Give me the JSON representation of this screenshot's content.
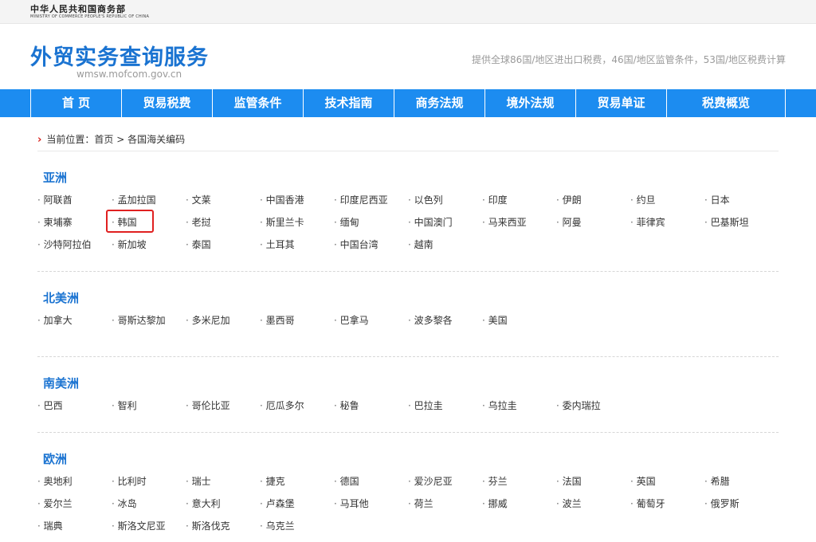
{
  "top": {
    "ministry_cn": "中华人民共和国商务部",
    "ministry_en": "MINISTRY OF COMMERCE PEOPLE'S REPUBLIC OF CHINA"
  },
  "header": {
    "title": "外贸实务查询服务",
    "url": "wmsw.mofcom.gov.cn",
    "note": "提供全球86国/地区进出口税费，46国/地区监管条件，53国/地区税费计算"
  },
  "nav": [
    "首 页",
    "贸易税费",
    "监管条件",
    "技术指南",
    "商务法规",
    "境外法规",
    "贸易单证",
    "税费概览"
  ],
  "breadcrumb": {
    "prefix": "当前位置：",
    "home": "首页",
    "sep": " > ",
    "current": "各国海关编码"
  },
  "regions": [
    {
      "title": "亚洲",
      "countries": [
        "阿联酋",
        "孟加拉国",
        "文莱",
        "中国香港",
        "印度尼西亚",
        "以色列",
        "印度",
        "伊朗",
        "约旦",
        "日本",
        "柬埔寨",
        "韩国",
        "老挝",
        "斯里兰卡",
        "缅甸",
        "中国澳门",
        "马来西亚",
        "阿曼",
        "菲律宾",
        "巴基斯坦",
        "沙特阿拉伯",
        "新加坡",
        "泰国",
        "土耳其",
        "中国台湾",
        "越南"
      ]
    },
    {
      "title": "北美洲",
      "countries": [
        "加拿大",
        "哥斯达黎加",
        "多米尼加",
        "墨西哥",
        "巴拿马",
        "波多黎各",
        "美国"
      ]
    },
    {
      "title": "南美洲",
      "countries": [
        "巴西",
        "智利",
        "哥伦比亚",
        "厄瓜多尔",
        "秘鲁",
        "巴拉圭",
        "乌拉圭",
        "委内瑞拉"
      ]
    },
    {
      "title": "欧洲",
      "countries": [
        "奥地利",
        "比利时",
        "瑞士",
        "捷克",
        "德国",
        "爱沙尼亚",
        "芬兰",
        "法国",
        "英国",
        "希腊",
        "爱尔兰",
        "冰岛",
        "意大利",
        "卢森堡",
        "马耳他",
        "荷兰",
        "挪威",
        "波兰",
        "葡萄牙",
        "俄罗斯",
        "瑞典",
        "斯洛文尼亚",
        "斯洛伐克",
        "乌克兰"
      ]
    }
  ],
  "highlight": {
    "region": 0,
    "country": "韩国",
    "color": "#e02020"
  },
  "colors": {
    "nav_bg": "#1c8cf0",
    "title": "#1a73d1",
    "breadcrumb_arrow": "#d8231e"
  }
}
